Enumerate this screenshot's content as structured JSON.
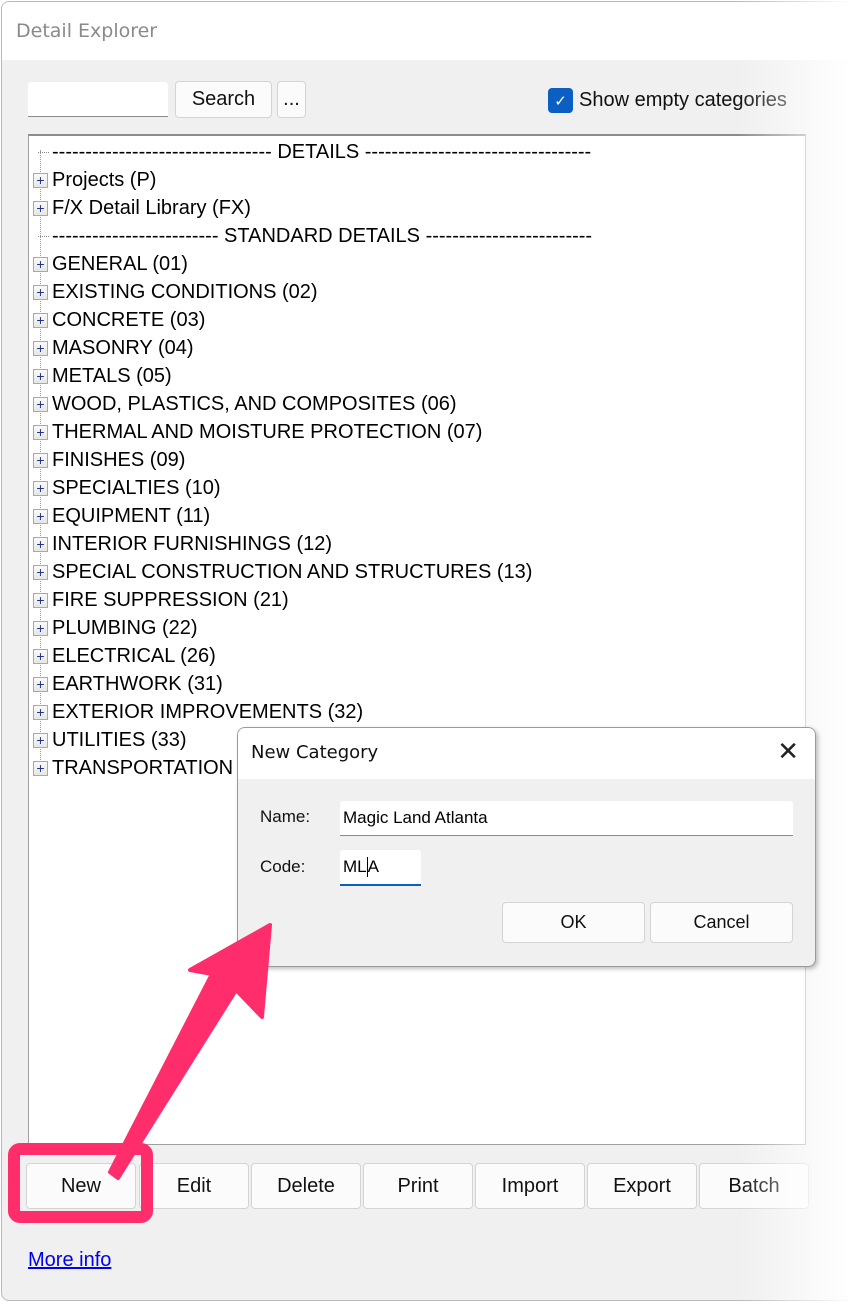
{
  "window": {
    "title": "Detail Explorer"
  },
  "toolbar": {
    "search_value": "",
    "search_label": "Search",
    "more_label": "...",
    "show_empty_label": "Show empty categories",
    "show_empty_checked": true
  },
  "tree": {
    "rows": [
      {
        "type": "separator",
        "label": "--------------------------------- DETAILS ----------------------------------"
      },
      {
        "type": "node",
        "label": "Projects (P)"
      },
      {
        "type": "node",
        "label": "F/X Detail Library (FX)"
      },
      {
        "type": "separator",
        "label": "------------------------- STANDARD DETAILS -------------------------"
      },
      {
        "type": "node",
        "label": "GENERAL (01)"
      },
      {
        "type": "node",
        "label": "EXISTING CONDITIONS (02)"
      },
      {
        "type": "node",
        "label": "CONCRETE (03)"
      },
      {
        "type": "node",
        "label": "MASONRY (04)"
      },
      {
        "type": "node",
        "label": "METALS (05)"
      },
      {
        "type": "node",
        "label": "WOOD, PLASTICS, AND COMPOSITES (06)"
      },
      {
        "type": "node",
        "label": "THERMAL AND MOISTURE PROTECTION (07)"
      },
      {
        "type": "node",
        "label": "FINISHES (09)"
      },
      {
        "type": "node",
        "label": "SPECIALTIES (10)"
      },
      {
        "type": "node",
        "label": "EQUIPMENT (11)"
      },
      {
        "type": "node",
        "label": "INTERIOR FURNISHINGS (12)"
      },
      {
        "type": "node",
        "label": "SPECIAL CONSTRUCTION AND STRUCTURES (13)"
      },
      {
        "type": "node",
        "label": "FIRE SUPPRESSION (21)"
      },
      {
        "type": "node",
        "label": "PLUMBING (22)"
      },
      {
        "type": "node",
        "label": "ELECTRICAL (26)"
      },
      {
        "type": "node",
        "label": "EARTHWORK (31)"
      },
      {
        "type": "node",
        "label": "EXTERIOR IMPROVEMENTS (32)"
      },
      {
        "type": "node",
        "label": "UTILITIES (33)"
      },
      {
        "type": "node",
        "label": "TRANSPORTATION"
      }
    ]
  },
  "buttons": {
    "new": "New",
    "edit": "Edit",
    "delete": "Delete",
    "print": "Print",
    "import": "Import",
    "export": "Export",
    "batch": "Batch"
  },
  "footer": {
    "more_info": "More info"
  },
  "dialog": {
    "title": "New Category",
    "close_icon": "close-icon",
    "name_label": "Name:",
    "name_value": "Magic Land Atlanta",
    "code_label": "Code:",
    "code_value_before_caret": "ML",
    "code_value_after_caret": "A",
    "ok_label": "OK",
    "cancel_label": "Cancel"
  },
  "annotation": {
    "color": "#ff2d6b",
    "highlight_target": "New button",
    "arrow_points_to": "New Category dialog"
  },
  "colors": {
    "accent": "#0b5fc3",
    "link": "#0000ee"
  }
}
